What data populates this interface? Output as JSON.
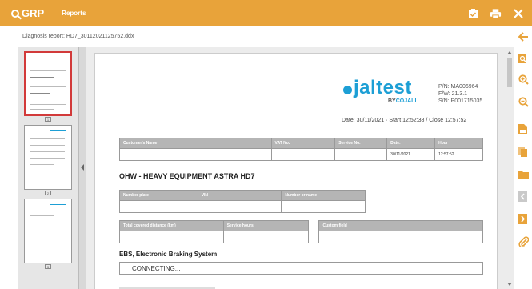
{
  "topbar": {
    "app_name": "GRP",
    "section_label": "Reports",
    "icons": [
      "search-icon",
      "clipboard-check-icon",
      "print-icon",
      "close-icon"
    ],
    "accent_color": "#e8a33a"
  },
  "file_path": "Diagnosis report: HD7_30112021125752.ddx",
  "thumbnails": {
    "page_numbers": [
      "1",
      "2",
      "3"
    ],
    "selected_index": 0
  },
  "report": {
    "brand": "jaltest",
    "by": "BY",
    "maker": "COJALI",
    "pn": "P/N: MA006964",
    "fw": "F/W: 21.3.1",
    "sn": "S/N: P001715035",
    "date_line": "Date: 30/11/2021 · Start 12:52:38 / Close 12:57:52",
    "customer_table": {
      "headers": [
        "Customer's Name",
        "VAT No.",
        "Service No.",
        "Date:",
        "Hour"
      ],
      "values": [
        "",
        "",
        "",
        "30/11/2021",
        "12:57:52"
      ]
    },
    "vehicle_title": "OHW - HEAVY EQUIPMENT  ASTRA  HD7",
    "vehicle_table": {
      "headers": [
        "Number plate",
        "VIN",
        "Number or name"
      ],
      "values": [
        "",
        "",
        ""
      ]
    },
    "distance_table": {
      "headers": [
        "Total covered distance (km)",
        "Service hours",
        "Custom field"
      ],
      "values": [
        "",
        "",
        ""
      ]
    },
    "system_title": "EBS, Electronic Braking System",
    "status": "CONNECTING..."
  },
  "right_toolbar": {
    "icons": [
      "back-arrow-icon",
      "zoom-document-icon",
      "zoom-in-icon",
      "zoom-out-icon",
      "save-document-icon",
      "copy-document-icon",
      "open-folder-icon",
      "previous-document-icon",
      "next-document-icon",
      "attachment-icon"
    ]
  }
}
